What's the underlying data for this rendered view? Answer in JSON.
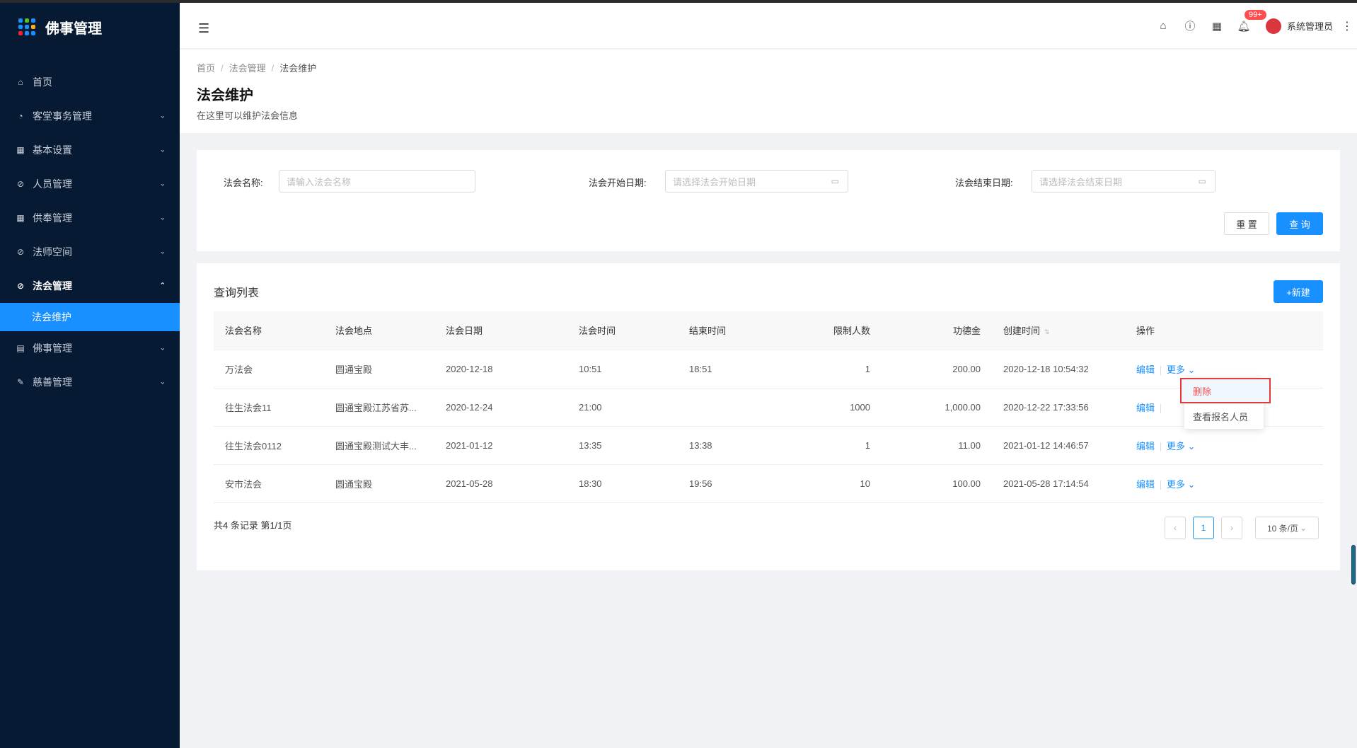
{
  "app": {
    "title": "佛事管理"
  },
  "sidebar": {
    "items": [
      {
        "label": "首页",
        "icon": "home-icon",
        "expandable": false
      },
      {
        "label": "客堂事务管理",
        "icon": "dashboard-icon",
        "expandable": true
      },
      {
        "label": "基本设置",
        "icon": "table-icon",
        "expandable": true
      },
      {
        "label": "人员管理",
        "icon": "check-circle-icon",
        "expandable": true
      },
      {
        "label": "供奉管理",
        "icon": "table-icon",
        "expandable": true
      },
      {
        "label": "法师空间",
        "icon": "check-circle-icon",
        "expandable": true
      },
      {
        "label": "法会管理",
        "icon": "check-circle-icon",
        "expandable": true,
        "open": true
      },
      {
        "label": "法会维护",
        "sub": true,
        "active": true
      },
      {
        "label": "佛事管理",
        "icon": "document-icon",
        "expandable": true
      },
      {
        "label": "慈善管理",
        "icon": "edit-icon",
        "expandable": true
      }
    ]
  },
  "header": {
    "notification_badge": "99+",
    "user_name": "系统管理员"
  },
  "breadcrumb": [
    "首页",
    "法会管理",
    "法会维护"
  ],
  "page": {
    "title": "法会维护",
    "subtitle": "在这里可以维护法会信息"
  },
  "search": {
    "name_label": "法会名称:",
    "name_placeholder": "请输入法会名称",
    "start_label": "法会开始日期:",
    "start_placeholder": "请选择法会开始日期",
    "end_label": "法会结束日期:",
    "end_placeholder": "请选择法会结束日期",
    "reset_label": "重 置",
    "query_label": "查 询"
  },
  "list": {
    "title": "查询列表",
    "new_label": "+新建",
    "columns": [
      "法会名称",
      "法会地点",
      "法会日期",
      "法会时间",
      "结束时间",
      "限制人数",
      "功德金",
      "创建时间",
      "操作"
    ],
    "rows": [
      [
        "万法会",
        "圆通宝殿",
        "2020-12-18",
        "10:51",
        "18:51",
        "1",
        "200.00",
        "2020-12-18 10:54:32"
      ],
      [
        "往生法会11",
        "圆通宝殿江苏省苏...",
        "2020-12-24",
        "21:00",
        "",
        "1000",
        "1,000.00",
        "2020-12-22 17:33:56"
      ],
      [
        "往生法会0112",
        "圆通宝殿测试大丰...",
        "2021-01-12",
        "13:35",
        "13:38",
        "1",
        "11.00",
        "2021-01-12 14:46:57"
      ],
      [
        "安市法会",
        "圆通宝殿",
        "2021-05-28",
        "18:30",
        "19:56",
        "10",
        "100.00",
        "2021-05-28 17:14:54"
      ]
    ],
    "edit_label": "编辑",
    "more_label": "更多",
    "summary": "共4 条记录 第1/1页",
    "current_page": "1",
    "page_size": "10 条/页"
  },
  "dropdown": {
    "delete_label": "删除",
    "view_label": "查看报名人员"
  },
  "colors": {
    "sidebar_bg": "#071a33",
    "accent": "#1890ff",
    "danger": "#ff4d4f"
  }
}
